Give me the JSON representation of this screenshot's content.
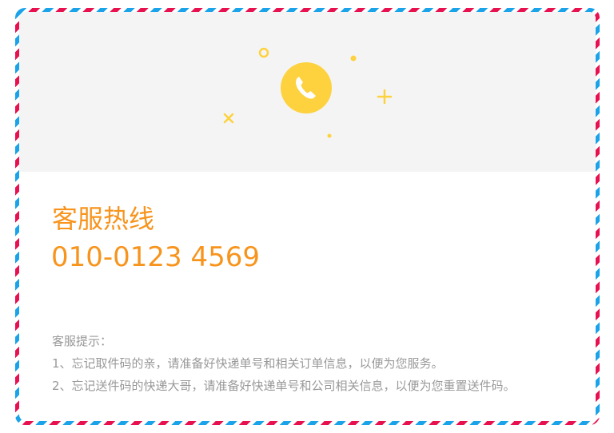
{
  "colors": {
    "stripe_red": "#e8114f",
    "stripe_blue": "#1aa3e8",
    "accent_orange": "#f7941d",
    "icon_yellow": "#fdd23e",
    "banner_bg": "#f4f4f4",
    "tip_text": "#999999"
  },
  "banner": {
    "icon": "phone-icon",
    "decorations": [
      "circle",
      "dot",
      "plus",
      "cross",
      "dot"
    ]
  },
  "hotline": {
    "title": "客服热线",
    "number": "010-0123 4569"
  },
  "tips": {
    "heading": "客服提示：",
    "items": [
      "1、忘记取件码的亲，请准备好快递单号和相关订单信息，以便为您服务。",
      "2、忘记送件码的快递大哥，请准备好快递单号和公司相关信息，以便为您重置送件码。"
    ]
  }
}
